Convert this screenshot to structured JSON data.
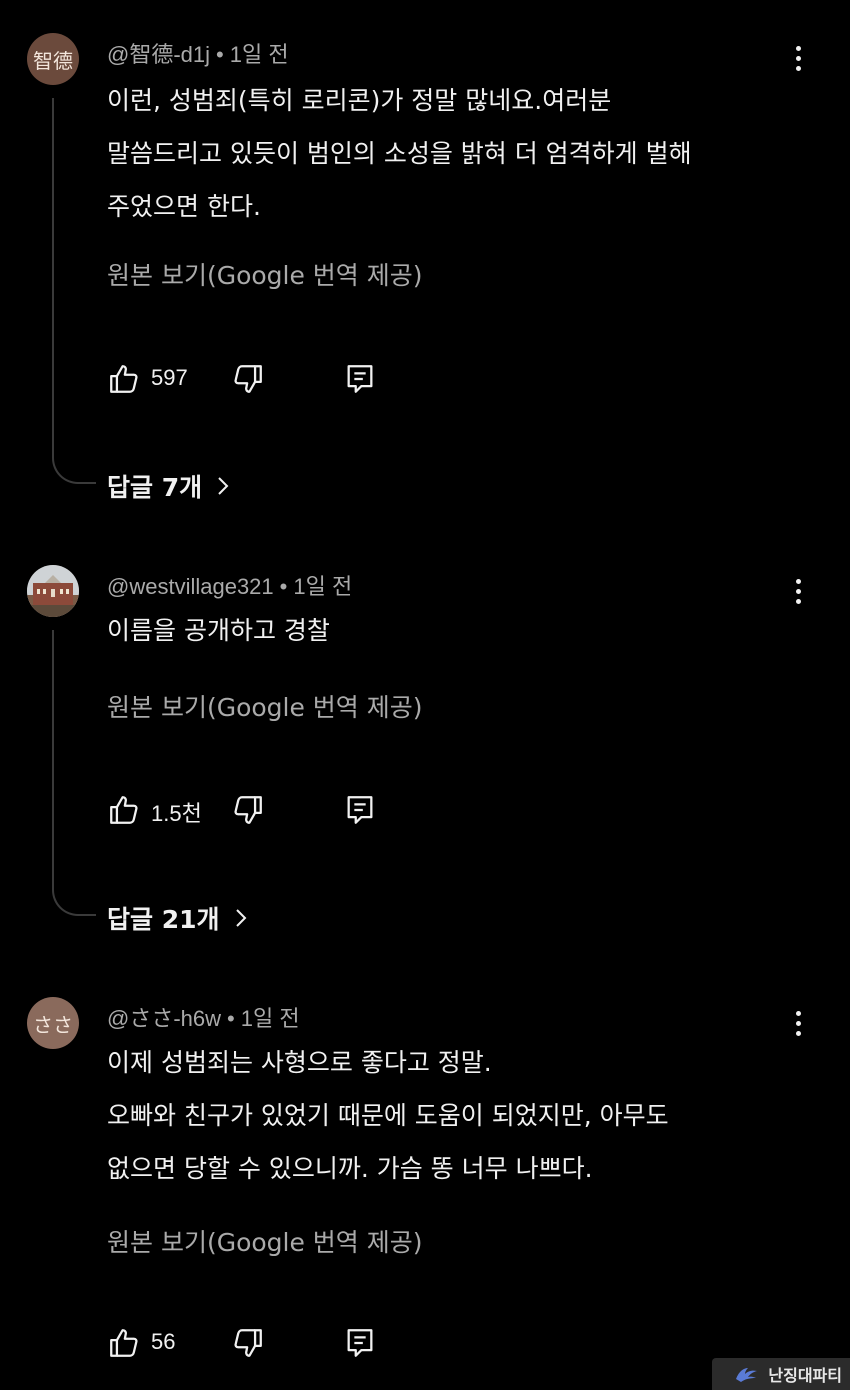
{
  "comments": [
    {
      "avatar_text": "智德",
      "avatar_color": "#6b4a3c",
      "handle": "@智德-d1j",
      "time": "1일 전",
      "text_lines": [
        "이런, 성범죄(특히 로리콘)가 정말 많네요.여러분",
        "말씀드리고 있듯이 범인의 소성을 밝혀 더 엄격하게 벌해",
        "주었으면 한다."
      ],
      "translate": "원본 보기(Google 번역 제공)",
      "likes": "597",
      "replies": "답글 7개"
    },
    {
      "avatar_text": "",
      "avatar_icon": "building-photo",
      "handle": "@westvillage321",
      "time": "1일 전",
      "text_lines": [
        "이름을 공개하고 경찰"
      ],
      "translate": "원본 보기(Google 번역 제공)",
      "likes": "1.5천",
      "replies": "답글 21개"
    },
    {
      "avatar_text": "ささ",
      "avatar_color": "#8a6a5c",
      "handle": "@ささ-h6w",
      "time": "1일 전",
      "text_lines": [
        "이제 성범죄는 사형으로 좋다고 정말.",
        "오빠와 친구가 있었기 때문에 도움이 되었지만, 아무도",
        "없으면 당할 수 있으니까. 가슴 똥 너무 나쁘다."
      ],
      "translate": "원본 보기(Google 번역 제공)",
      "likes": "56"
    }
  ],
  "watermark": "난징대파티"
}
